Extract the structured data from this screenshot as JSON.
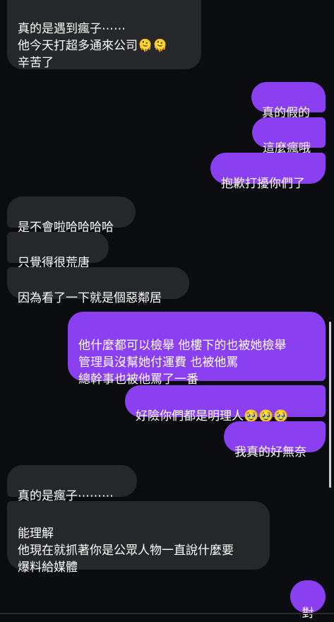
{
  "conversation": {
    "messages": [
      {
        "side": "in",
        "text": "真的是遇到瘋子⋯⋯\n他今天打超多通來公司🫠🫠\n辛苦了"
      },
      {
        "side": "out",
        "text": "真的假的"
      },
      {
        "side": "out",
        "text": "這麼瘋哦"
      },
      {
        "side": "out",
        "text": "抱歉打擾你們了"
      },
      {
        "side": "in",
        "text": "是不會啦哈哈哈哈"
      },
      {
        "side": "in",
        "text": "只覺得很荒唐"
      },
      {
        "side": "in",
        "text": "因為看了一下就是個惡鄰居"
      },
      {
        "side": "out",
        "text": "他什麼都可以檢舉 他樓下的也被她檢舉\n管理員沒幫她付運費 也被他罵\n總幹事也被他罵了一番"
      },
      {
        "side": "out",
        "text": "好險你們都是明理人🥹🥹🥹"
      },
      {
        "side": "out",
        "text": "我真的好無奈"
      },
      {
        "side": "in",
        "text": "真的是瘋子⋯⋯⋯"
      },
      {
        "side": "in",
        "text": "能理解\n他現在就抓著你是公眾人物一直說什麼要\n爆料給媒體"
      },
      {
        "side": "out",
        "text": "對"
      }
    ]
  }
}
